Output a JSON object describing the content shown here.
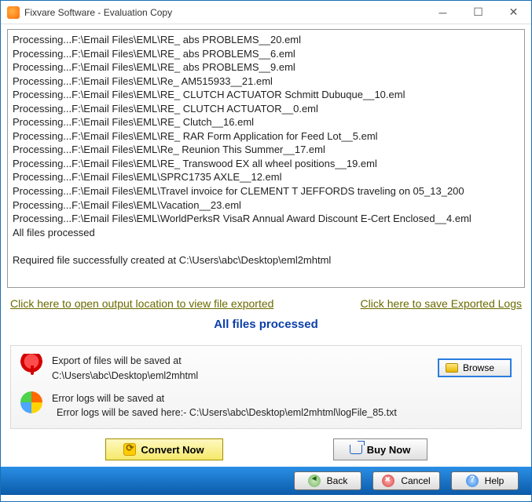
{
  "window": {
    "title": "Fixvare Software - Evaluation Copy"
  },
  "log": {
    "lines": [
      "Processing...F:\\Email Files\\EML\\RE_ abs PROBLEMS__20.eml",
      "Processing...F:\\Email Files\\EML\\RE_ abs PROBLEMS__6.eml",
      "Processing...F:\\Email Files\\EML\\RE_ abs PROBLEMS__9.eml",
      "Processing...F:\\Email Files\\EML\\Re_ AM515933__21.eml",
      "Processing...F:\\Email Files\\EML\\RE_ CLUTCH ACTUATOR Schmitt Dubuque__10.eml",
      "Processing...F:\\Email Files\\EML\\RE_ CLUTCH ACTUATOR__0.eml",
      "Processing...F:\\Email Files\\EML\\RE_ Clutch__16.eml",
      "Processing...F:\\Email Files\\EML\\RE_ RAR Form Application for Feed Lot__5.eml",
      "Processing...F:\\Email Files\\EML\\Re_ Reunion This Summer__17.eml",
      "Processing...F:\\Email Files\\EML\\RE_ Transwood EX all wheel positions__19.eml",
      "Processing...F:\\Email Files\\EML\\SPRC1735 AXLE__12.eml",
      "Processing...F:\\Email Files\\EML\\Travel invoice for CLEMENT T JEFFORDS traveling on 05_13_200",
      "Processing...F:\\Email Files\\EML\\Vacation__23.eml",
      "Processing...F:\\Email Files\\EML\\WorldPerksR VisaR Annual Award Discount E-Cert Enclosed__4.eml",
      "All files processed",
      "",
      "Required file successfully created at C:\\Users\\abc\\Desktop\\eml2mhtml"
    ]
  },
  "links": {
    "open_output": "Click here to open output location to view file exported",
    "save_logs": "Click here to save Exported Logs"
  },
  "status": "All files processed",
  "export": {
    "label": "Export of files will be saved at",
    "path": "C:\\Users\\abc\\Desktop\\eml2mhtml",
    "browse": "Browse"
  },
  "errorlogs": {
    "label": "Error logs will be saved at",
    "path": "Error logs will be saved here:- C:\\Users\\abc\\Desktop\\eml2mhtml\\logFile_85.txt"
  },
  "actions": {
    "convert": "Convert Now",
    "buy": "Buy Now"
  },
  "footer": {
    "back": "Back",
    "cancel": "Cancel",
    "help": "Help"
  }
}
